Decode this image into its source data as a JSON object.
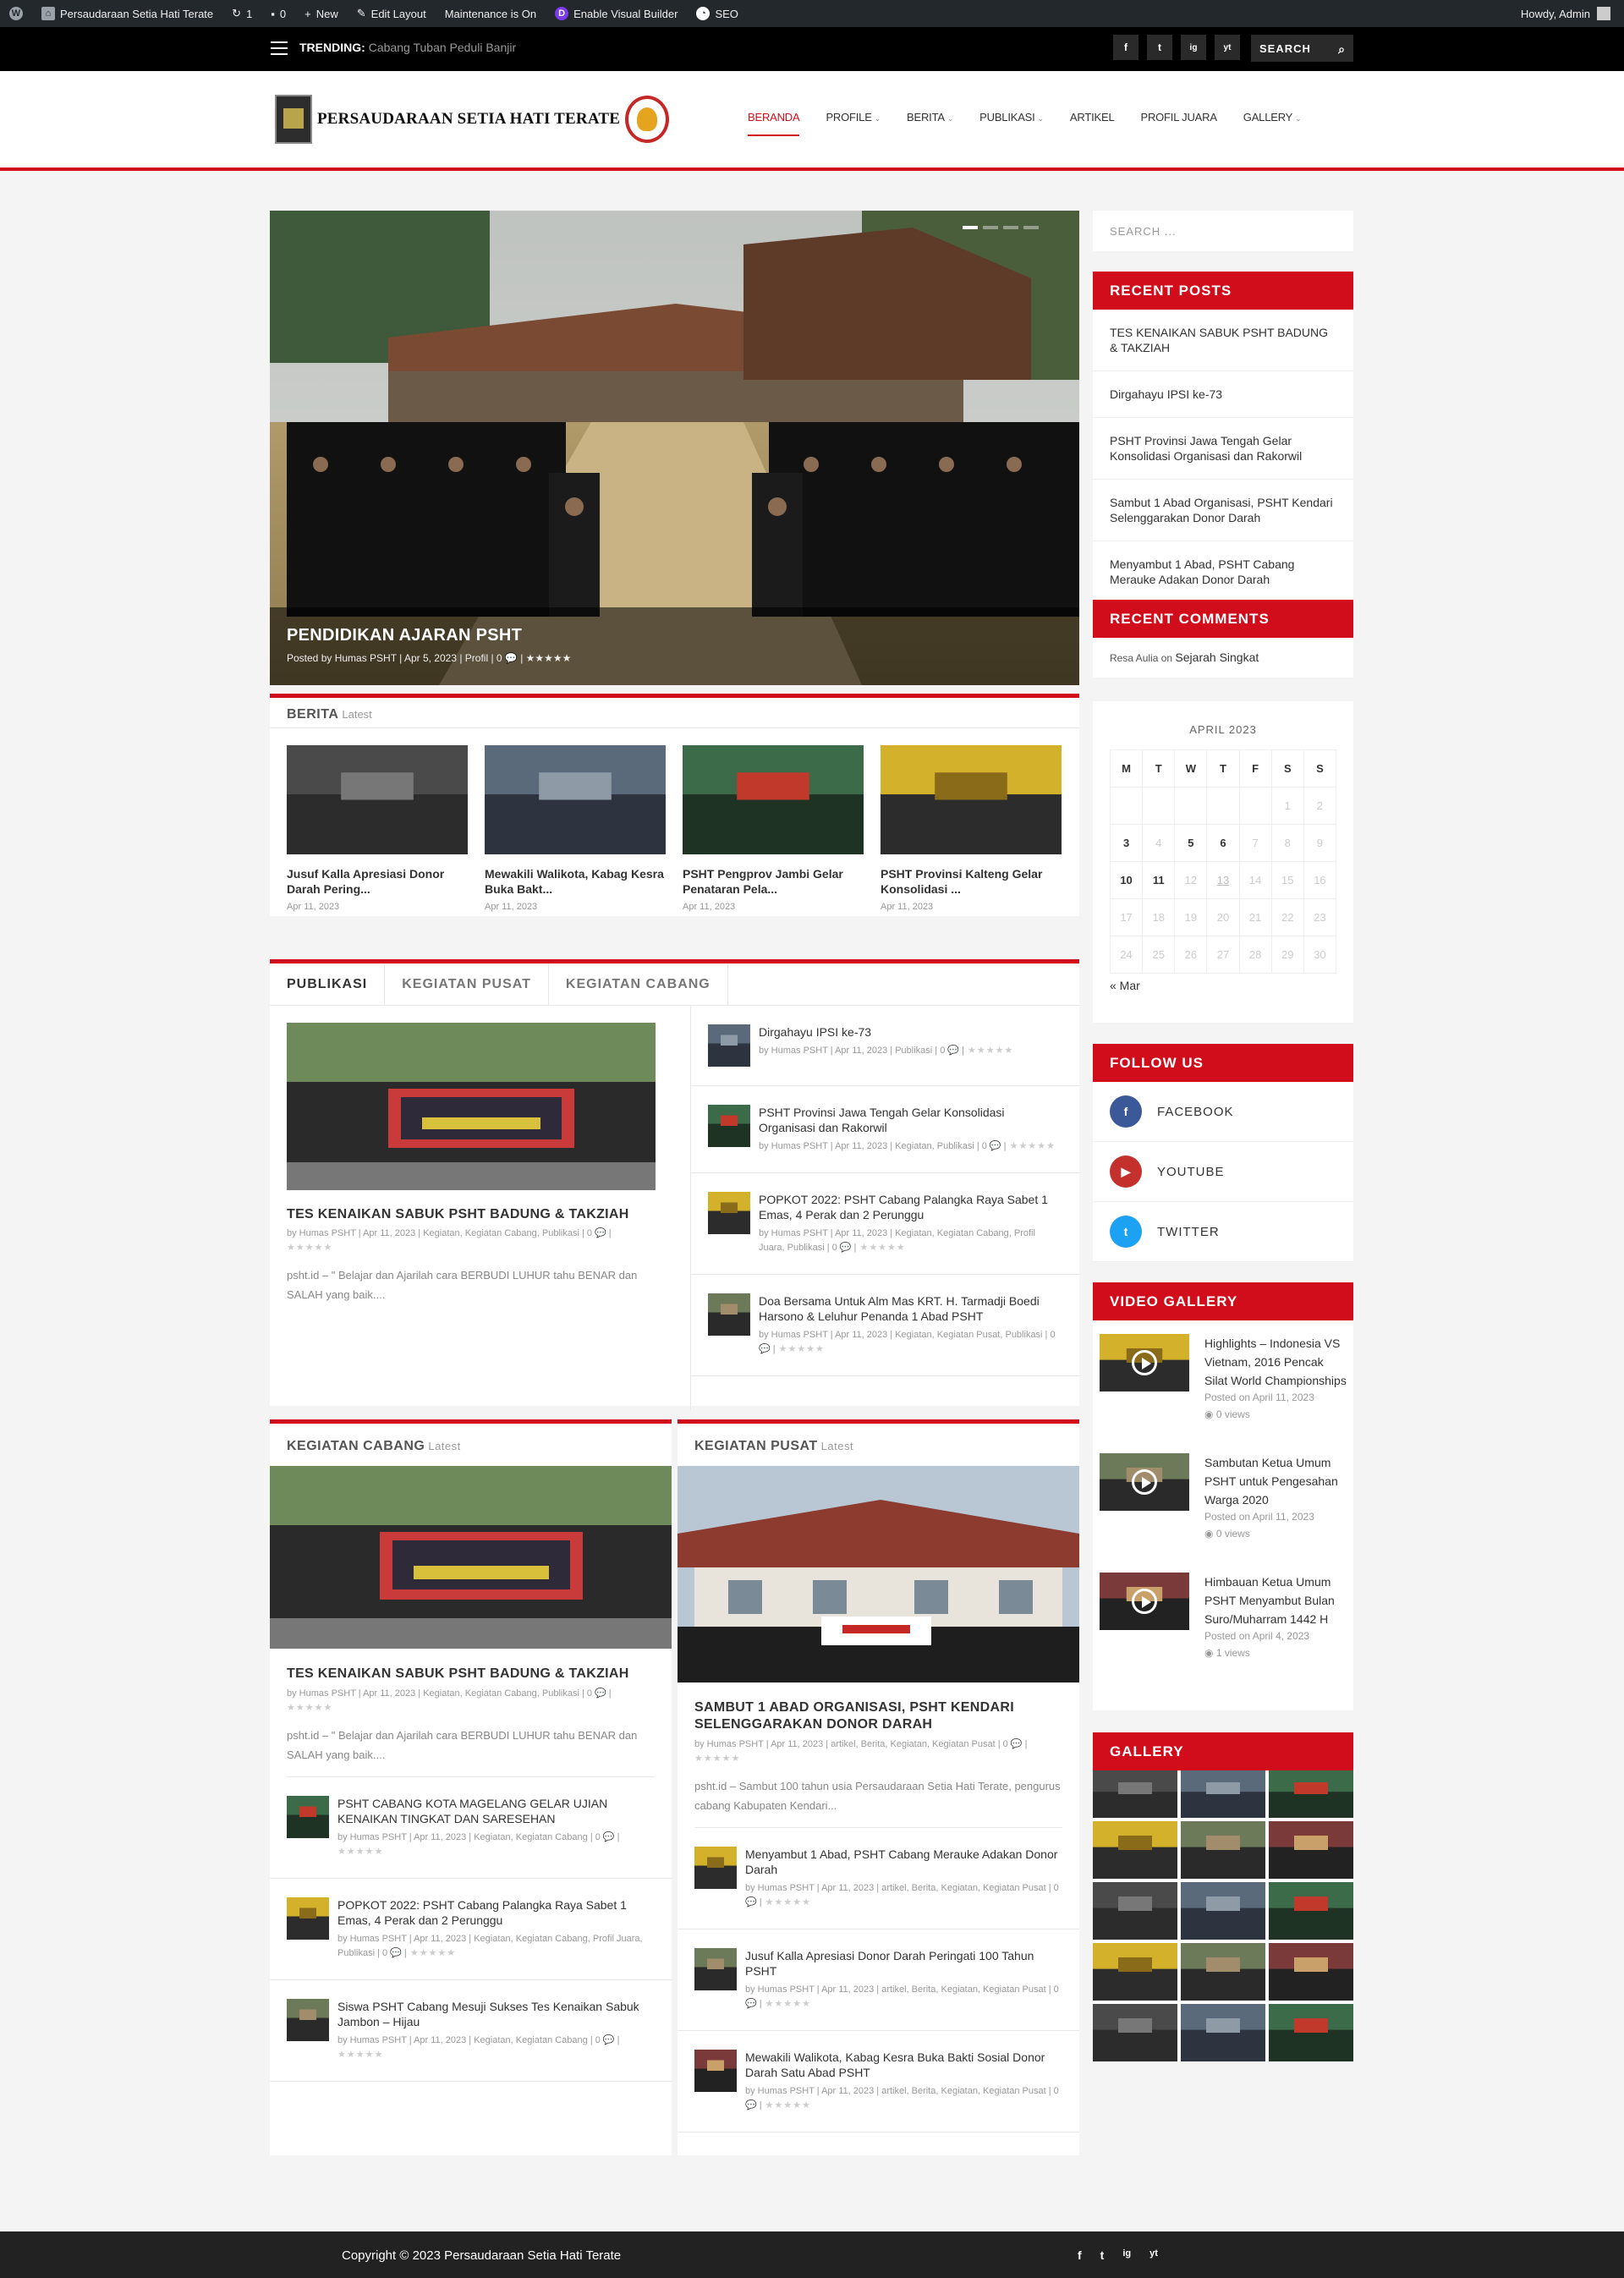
{
  "admin_bar": {
    "site_name": "Persaudaraan Setia Hati Terate",
    "updates_count": "1",
    "comments_count": "0",
    "new_label": "New",
    "edit_layout_label": "Edit Layout",
    "maintenance_label": "Maintenance is On",
    "visual_builder_label": "Enable Visual Builder",
    "seo_label": "SEO",
    "greeting": "Howdy, Admin"
  },
  "top_bar": {
    "trending_label": "TRENDING:",
    "trending_text": "Cabang Tuban Peduli Banjir",
    "search_label": "SEARCH",
    "socials": [
      "f",
      "t",
      "ig",
      "yt"
    ]
  },
  "header": {
    "logo_text": "PERSAUDARAAN SETIA HATI TERATE",
    "nav": [
      {
        "label": "BERANDA",
        "active": true,
        "caret": false
      },
      {
        "label": "PROFILE",
        "active": false,
        "caret": true
      },
      {
        "label": "BERITA",
        "active": false,
        "caret": true
      },
      {
        "label": "PUBLIKASI",
        "active": false,
        "caret": true
      },
      {
        "label": "ARTIKEL",
        "active": false,
        "caret": false
      },
      {
        "label": "PROFIL JUARA",
        "active": false,
        "caret": false
      },
      {
        "label": "GALLERY",
        "active": false,
        "caret": true
      }
    ],
    "accent_color": "#d10d1b"
  },
  "slider": {
    "title": "PENDIDIKAN AJARAN PSHT",
    "meta": "Posted by Humas PSHT | Apr 5, 2023 | Profil | 0 💬 | ★★★★★"
  },
  "berita": {
    "title": "BERITA",
    "subtitle": "Latest",
    "items": [
      {
        "title": "Jusuf Kalla Apresiasi Donor Darah Pering...",
        "date": "Apr 11, 2023"
      },
      {
        "title": "Mewakili Walikota, Kabag Kesra Buka Bakt...",
        "date": "Apr 11, 2023"
      },
      {
        "title": "PSHT Pengprov Jambi Gelar Penataran Pela...",
        "date": "Apr 11, 2023"
      },
      {
        "title": "PSHT Provinsi Kalteng Gelar Konsolidasi ...",
        "date": "Apr 11, 2023"
      }
    ]
  },
  "publikasi": {
    "tabs": [
      "PUBLIKASI",
      "KEGIATAN PUSAT",
      "KEGIATAN CABANG"
    ],
    "feature": {
      "title": "TES KENAIKAN SABUK PSHT BADUNG & TAKZIAH",
      "meta": "by Humas PSHT | Apr 11, 2023 | Kegiatan, Kegiatan Cabang, Publikasi | 0 💬 |",
      "excerpt": "psht.id – \" Belajar dan Ajarilah cara BERBUDI LUHUR tahu BENAR dan SALAH yang baik...."
    },
    "list": [
      {
        "title": "Dirgahayu IPSI ke-73",
        "meta": "by Humas PSHT | Apr 11, 2023 | Publikasi | 0 💬 |"
      },
      {
        "title": "PSHT Provinsi Jawa Tengah Gelar Konsolidasi Organisasi dan Rakorwil",
        "meta": "by Humas PSHT | Apr 11, 2023 | Kegiatan, Publikasi | 0 💬 |"
      },
      {
        "title": "POPKOT 2022: PSHT Cabang Palangka Raya Sabet 1 Emas, 4 Perak dan 2 Perunggu",
        "meta": "by Humas PSHT | Apr 11, 2023 | Kegiatan, Kegiatan Cabang, Profil Juara, Publikasi | 0 💬 |"
      },
      {
        "title": "Doa Bersama Untuk Alm Mas KRT. H. Tarmadji Boedi Harsono & Leluhur Penanda 1 Abad PSHT",
        "meta": "by Humas PSHT | Apr 11, 2023 | Kegiatan, Kegiatan Pusat, Publikasi | 0 💬 |"
      }
    ]
  },
  "kegiatan_cabang": {
    "title": "KEGIATAN CABANG",
    "subtitle": "Latest",
    "feature": {
      "title": "TES KENAIKAN SABUK PSHT BADUNG & TAKZIAH",
      "meta": "by Humas PSHT | Apr 11, 2023 | Kegiatan, Kegiatan Cabang, Publikasi | 0 💬 |",
      "excerpt": "psht.id – \" Belajar dan Ajarilah cara BERBUDI LUHUR tahu BENAR dan SALAH yang baik...."
    },
    "list": [
      {
        "title": "PSHT CABANG KOTA MAGELANG GELAR UJIAN KENAIKAN TINGKAT DAN SARESEHAN",
        "meta": "by Humas PSHT | Apr 11, 2023 | Kegiatan, Kegiatan Cabang | 0 💬 |"
      },
      {
        "title": "POPKOT 2022: PSHT Cabang Palangka Raya Sabet 1 Emas, 4 Perak dan 2 Perunggu",
        "meta": "by Humas PSHT | Apr 11, 2023 | Kegiatan, Kegiatan Cabang, Profil Juara, Publikasi | 0 💬 |"
      },
      {
        "title": "Siswa PSHT Cabang Mesuji Sukses Tes Kenaikan Sabuk Jambon – Hijau",
        "meta": "by Humas PSHT | Apr 11, 2023 | Kegiatan, Kegiatan Cabang | 0 💬 |"
      }
    ]
  },
  "kegiatan_pusat": {
    "title": "KEGIATAN PUSAT",
    "subtitle": "Latest",
    "feature": {
      "title": "SAMBUT 1 ABAD ORGANISASI, PSHT KENDARI SELENGGARAKAN DONOR DARAH",
      "meta": "by Humas PSHT | Apr 11, 2023 | artikel, Berita, Kegiatan, Kegiatan Pusat | 0 💬 |",
      "excerpt": "psht.id – Sambut 100 tahun usia Persaudaraan Setia Hati Terate, pengurus cabang Kabupaten Kendari..."
    },
    "list": [
      {
        "title": "Menyambut 1 Abad, PSHT Cabang Merauke Adakan Donor Darah",
        "meta": "by Humas PSHT | Apr 11, 2023 | artikel, Berita, Kegiatan, Kegiatan Pusat | 0 💬 |"
      },
      {
        "title": "Jusuf Kalla Apresiasi Donor Darah Peringati 100 Tahun PSHT",
        "meta": "by Humas PSHT | Apr 11, 2023 | artikel, Berita, Kegiatan, Kegiatan Pusat | 0 💬 |"
      },
      {
        "title": "Mewakili Walikota, Kabag Kesra Buka Bakti Sosial Donor Darah Satu Abad PSHT",
        "meta": "by Humas PSHT | Apr 11, 2023 | artikel, Berita, Kegiatan, Kegiatan Pusat | 0 💬 |"
      }
    ]
  },
  "sidebar": {
    "search_placeholder": "SEARCH ...",
    "recent_posts_title": "RECENT POSTS",
    "recent_posts": [
      "TES KENAIKAN SABUK PSHT BADUNG & TAKZIAH",
      "Dirgahayu IPSI ke-73",
      "PSHT Provinsi Jawa Tengah Gelar Konsolidasi Organisasi dan Rakorwil",
      "Sambut 1 Abad Organisasi, PSHT Kendari Selenggarakan Donor Darah",
      "Menyambut 1 Abad, PSHT Cabang Merauke Adakan Donor Darah"
    ],
    "recent_comments_title": "RECENT COMMENTS",
    "comment_author": "Resa Aulia",
    "comment_on": "on",
    "comment_post": "Sejarah Singkat",
    "calendar": {
      "title": "APRIL 2023",
      "headers": [
        "M",
        "T",
        "W",
        "T",
        "F",
        "S",
        "S"
      ],
      "rows": [
        [
          "",
          "",
          "",
          "",
          "",
          "1",
          "2"
        ],
        [
          "3",
          "4",
          "5",
          "6",
          "7",
          "8",
          "9"
        ],
        [
          "10",
          "11",
          "12",
          "13",
          "14",
          "15",
          "16"
        ],
        [
          "17",
          "18",
          "19",
          "20",
          "21",
          "22",
          "23"
        ],
        [
          "24",
          "25",
          "26",
          "27",
          "28",
          "29",
          "30"
        ]
      ],
      "bold_days": [
        "3",
        "5",
        "6",
        "10",
        "11"
      ],
      "today": "13",
      "prev_link": "« Mar"
    },
    "follow_title": "FOLLOW US",
    "follow": [
      {
        "label": "FACEBOOK",
        "icon": "facebook-icon",
        "color": "#3b5998",
        "glyph": "f"
      },
      {
        "label": "YOUTUBE",
        "icon": "youtube-icon",
        "color": "#c4302b",
        "glyph": "▶"
      },
      {
        "label": "TWITTER",
        "icon": "twitter-icon",
        "color": "#1da1f2",
        "glyph": "t"
      }
    ],
    "video_title": "VIDEO GALLERY",
    "videos": [
      {
        "title": "Highlights – Indonesia VS Vietnam, 2016 Pencak Silat World Championships",
        "date": "Posted on April 11, 2023",
        "views": "0 views"
      },
      {
        "title": "Sambutan Ketua Umum PSHT untuk Pengesahan Warga 2020",
        "date": "Posted on April 11, 2023",
        "views": "0 views"
      },
      {
        "title": "Himbauan Ketua Umum PSHT Menyambut Bulan Suro/Muharram 1442 H",
        "date": "Posted on April 4, 2023",
        "views": "1 views"
      }
    ],
    "gallery_title": "GALLERY"
  },
  "footer": {
    "copyright": "Copyright © 2023 Persaudaraan Setia Hati Terate",
    "socials": [
      "f",
      "t",
      "ig",
      "yt"
    ]
  }
}
